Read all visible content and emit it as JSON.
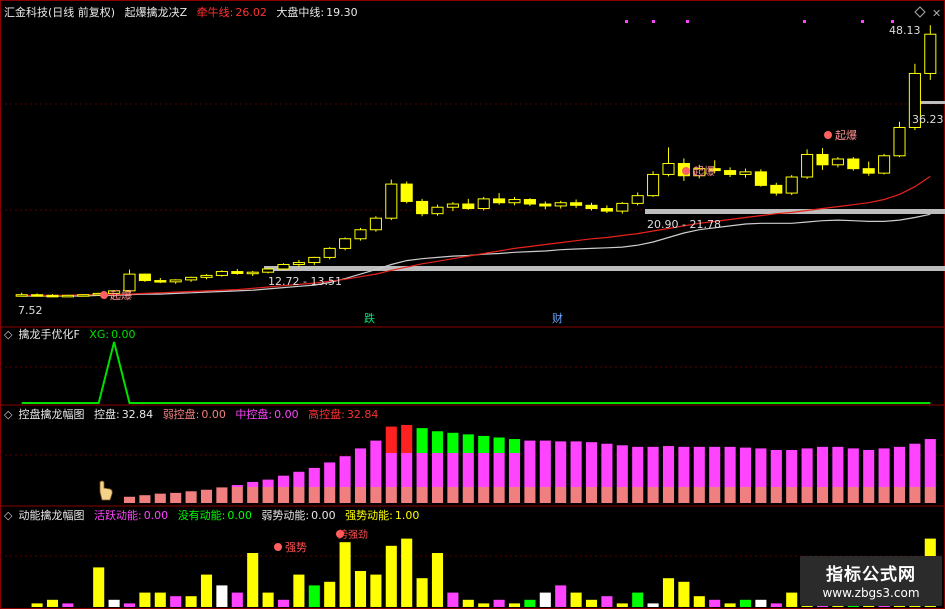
{
  "panel_main": {
    "stock_name": "汇金科技",
    "period": "(日线 前复权)",
    "indicator": "起爆擒龙决Z",
    "cow_label": "牵牛线:",
    "cow_value": "26.02",
    "market_label": "大盘中线:",
    "market_value": "19.30",
    "price_high": "48.13",
    "price_level_high": "36.23",
    "zone_mid": "20.90 - 21.78",
    "zone_low": "12.72 - 13.51",
    "price_low": "7.52",
    "marker_die": "跌",
    "marker_cai": "财",
    "tag_qibao": "起爆",
    "tag_qibao2": "起爆",
    "tag_qibao3": "起爆"
  },
  "panel_2": {
    "title": "擒龙手优化F",
    "xg_label": "XG:",
    "xg_value": "0.00"
  },
  "panel_3": {
    "title": "控盘擒龙幅图",
    "kp_label": "控盘:",
    "kp_value": "32.84",
    "ruo_label": "弱控盘:",
    "ruo_value": "0.00",
    "zhong_label": "中控盘:",
    "zhong_value": "0.00",
    "gao_label": "高控盘:",
    "gao_value": "32.84"
  },
  "panel_4": {
    "title": "动能擒龙幅图",
    "huoyue_label": "活跃动能:",
    "huoyue_value": "0.00",
    "meiyou_label": "没有动能:",
    "meiyou_value": "0.00",
    "ruoshi_label": "弱势动能:",
    "ruoshi_value": "0.00",
    "qiangshi_label": "强势动能:",
    "qiangshi_value": "1.00",
    "tag_qiangshi": "强势",
    "tag_shi": "势强劲"
  },
  "watermark": {
    "title": "指标公式网",
    "url": "www.zbgs3.com"
  },
  "colors": {
    "up": "#ffff00",
    "cow": "#e8231c",
    "market": "#cccccc",
    "xg": "#00e000",
    "pink": "#f08080",
    "magenta": "#ff44ff",
    "green": "#00ff00",
    "red": "#ff2020"
  },
  "chart_data": {
    "type": "candlestick",
    "ylim": [
      6,
      50
    ],
    "candles": [
      [
        7.5,
        7.9,
        7.3,
        7.6
      ],
      [
        7.6,
        7.8,
        7.4,
        7.5
      ],
      [
        7.5,
        7.7,
        7.3,
        7.4
      ],
      [
        7.4,
        7.6,
        7.3,
        7.5
      ],
      [
        7.5,
        7.7,
        7.4,
        7.6
      ],
      [
        7.6,
        7.9,
        7.5,
        7.8
      ],
      [
        7.8,
        8.3,
        7.7,
        8.2
      ],
      [
        8.2,
        11.5,
        8.0,
        10.8
      ],
      [
        10.8,
        10.9,
        9.6,
        9.8
      ],
      [
        9.8,
        10.2,
        9.4,
        9.6
      ],
      [
        9.6,
        10.0,
        9.3,
        9.9
      ],
      [
        9.9,
        10.4,
        9.6,
        10.3
      ],
      [
        10.3,
        10.8,
        10.0,
        10.6
      ],
      [
        10.6,
        11.4,
        10.4,
        11.2
      ],
      [
        11.2,
        11.6,
        10.7,
        10.9
      ],
      [
        10.9,
        11.3,
        10.5,
        11.1
      ],
      [
        11.1,
        11.8,
        10.9,
        11.6
      ],
      [
        11.6,
        12.5,
        11.4,
        12.3
      ],
      [
        12.3,
        13.0,
        11.9,
        12.6
      ],
      [
        12.6,
        13.5,
        12.2,
        13.4
      ],
      [
        13.4,
        15.0,
        13.1,
        14.8
      ],
      [
        14.8,
        16.5,
        14.5,
        16.3
      ],
      [
        16.3,
        18.0,
        16.0,
        17.7
      ],
      [
        17.7,
        19.8,
        17.4,
        19.5
      ],
      [
        19.5,
        25.5,
        19.2,
        24.8
      ],
      [
        24.8,
        25.2,
        21.8,
        22.1
      ],
      [
        22.1,
        22.5,
        19.8,
        20.2
      ],
      [
        20.2,
        21.6,
        19.9,
        21.2
      ],
      [
        21.2,
        22.0,
        20.6,
        21.7
      ],
      [
        21.7,
        22.5,
        20.8,
        21.0
      ],
      [
        21.0,
        22.8,
        20.7,
        22.5
      ],
      [
        22.5,
        23.4,
        21.6,
        21.9
      ],
      [
        21.9,
        22.8,
        21.5,
        22.4
      ],
      [
        22.4,
        22.6,
        21.4,
        21.7
      ],
      [
        21.7,
        22.1,
        20.9,
        21.4
      ],
      [
        21.4,
        22.2,
        21.0,
        21.9
      ],
      [
        21.9,
        22.4,
        21.1,
        21.5
      ],
      [
        21.5,
        21.9,
        20.7,
        21.0
      ],
      [
        21.0,
        21.5,
        20.3,
        20.6
      ],
      [
        20.6,
        22.0,
        20.2,
        21.8
      ],
      [
        21.8,
        23.5,
        21.5,
        23.0
      ],
      [
        23.0,
        26.8,
        22.8,
        26.3
      ],
      [
        26.3,
        30.5,
        26.0,
        28.0
      ],
      [
        28.0,
        28.8,
        25.3,
        26.1
      ],
      [
        26.1,
        27.8,
        25.7,
        27.2
      ],
      [
        27.2,
        28.5,
        26.5,
        26.9
      ],
      [
        26.9,
        27.4,
        25.9,
        26.3
      ],
      [
        26.3,
        27.2,
        25.8,
        26.7
      ],
      [
        26.7,
        27.1,
        24.4,
        24.6
      ],
      [
        24.6,
        25.0,
        23.0,
        23.4
      ],
      [
        23.4,
        26.2,
        23.1,
        25.9
      ],
      [
        25.9,
        30.2,
        25.6,
        29.4
      ],
      [
        29.4,
        30.4,
        27.0,
        27.8
      ],
      [
        27.8,
        29.0,
        27.4,
        28.7
      ],
      [
        28.7,
        29.0,
        26.9,
        27.2
      ],
      [
        27.2,
        28.3,
        26.1,
        26.5
      ],
      [
        26.5,
        29.5,
        26.3,
        29.2
      ],
      [
        29.2,
        34.5,
        29.0,
        33.6
      ],
      [
        33.6,
        43.5,
        33.2,
        42.0
      ],
      [
        42.0,
        49.5,
        41.0,
        48.1
      ]
    ],
    "ma_market": [
      7.4,
      7.4,
      7.4,
      7.4,
      7.4,
      7.5,
      7.5,
      7.6,
      7.7,
      7.7,
      7.8,
      7.9,
      8.0,
      8.1,
      8.2,
      8.3,
      8.5,
      8.7,
      8.9,
      9.1,
      9.5,
      10.1,
      10.8,
      11.5,
      12.3,
      12.9,
      13.2,
      13.4,
      13.6,
      13.7,
      13.9,
      14.0,
      14.2,
      14.3,
      14.4,
      14.6,
      14.7,
      14.8,
      14.9,
      15.0,
      15.3,
      15.8,
      16.5,
      17.2,
      17.7,
      18.0,
      18.3,
      18.6,
      18.7,
      18.7,
      18.7,
      18.9,
      19.1,
      19.2,
      19.1,
      19.0,
      19.0,
      19.2,
      19.6,
      20.1
    ],
    "ma_cow": [
      7.5,
      7.5,
      7.5,
      7.5,
      7.6,
      7.6,
      7.6,
      7.7,
      7.8,
      7.9,
      8.0,
      8.1,
      8.2,
      8.3,
      8.4,
      8.6,
      8.8,
      9.0,
      9.2,
      9.4,
      9.7,
      10.0,
      10.4,
      10.8,
      11.4,
      11.9,
      12.4,
      12.8,
      13.2,
      13.6,
      14.0,
      14.4,
      14.8,
      15.1,
      15.4,
      15.7,
      16.0,
      16.3,
      16.5,
      16.8,
      17.1,
      17.5,
      17.9,
      18.3,
      18.7,
      19.0,
      19.3,
      19.6,
      19.9,
      20.2,
      20.4,
      20.7,
      21.0,
      21.3,
      21.6,
      21.9,
      22.4,
      23.2,
      24.4,
      26.0
    ],
    "xg_signal": [
      0,
      0,
      0,
      0,
      0,
      0,
      1,
      0,
      0,
      0,
      0,
      0,
      0,
      0,
      0,
      0,
      0,
      0,
      0,
      0,
      0,
      0,
      0,
      0,
      0,
      0,
      0,
      0,
      0,
      0,
      0,
      0,
      0,
      0,
      0,
      0,
      0,
      0,
      0,
      0,
      0,
      0,
      0,
      0,
      0,
      0,
      0,
      0,
      0,
      0,
      0,
      0,
      0,
      0,
      0,
      0,
      0,
      0,
      0,
      0
    ],
    "kongpan": [
      0,
      0,
      0,
      0,
      0,
      0,
      0,
      0.08,
      0.1,
      0.12,
      0.13,
      0.15,
      0.17,
      0.2,
      0.23,
      0.27,
      0.3,
      0.35,
      0.4,
      0.45,
      0.52,
      0.6,
      0.7,
      0.8,
      0.98,
      1.0,
      0.96,
      0.92,
      0.9,
      0.88,
      0.86,
      0.84,
      0.82,
      0.8,
      0.8,
      0.79,
      0.79,
      0.78,
      0.76,
      0.74,
      0.72,
      0.72,
      0.73,
      0.72,
      0.72,
      0.72,
      0.72,
      0.71,
      0.7,
      0.68,
      0.68,
      0.7,
      0.72,
      0.72,
      0.7,
      0.68,
      0.7,
      0.72,
      0.76,
      0.82
    ],
    "dongneng": [
      0,
      0.05,
      0.1,
      0.05,
      0,
      0.55,
      0.1,
      0.05,
      0.2,
      0.2,
      0.15,
      0.15,
      0.45,
      0.3,
      0.2,
      0.75,
      0.2,
      0.1,
      0.45,
      0.3,
      0.35,
      0.9,
      0.5,
      0.45,
      0.85,
      0.95,
      0.4,
      0.75,
      0.2,
      0.1,
      0.05,
      0.1,
      0.05,
      0.1,
      0.2,
      0.3,
      0.2,
      0.1,
      0.15,
      0.05,
      0.2,
      0.05,
      0.4,
      0.35,
      0.15,
      0.1,
      0.05,
      0.1,
      0.1,
      0.05,
      0.2,
      0.35,
      0.15,
      0.1,
      0.05,
      0.35,
      0.1,
      0.2,
      0.3,
      0.95
    ]
  }
}
